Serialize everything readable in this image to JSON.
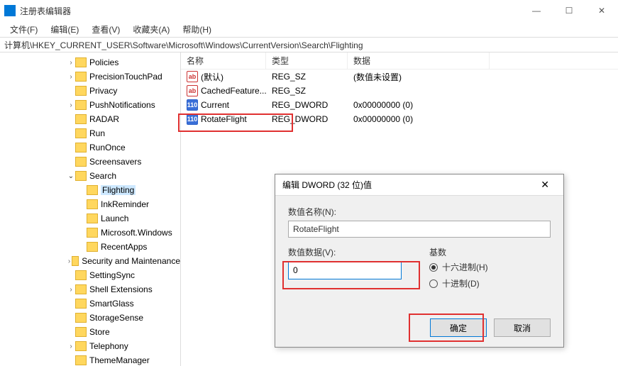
{
  "window": {
    "title": "注册表编辑器",
    "controls": {
      "min": "—",
      "max": "☐",
      "close": "✕"
    }
  },
  "menubar": {
    "file": "文件(F)",
    "edit": "编辑(E)",
    "view": "查看(V)",
    "favorites": "收藏夹(A)",
    "help": "帮助(H)"
  },
  "address": "计算机\\HKEY_CURRENT_USER\\Software\\Microsoft\\Windows\\CurrentVersion\\Search\\Flighting",
  "tree": {
    "items": [
      {
        "depth": 4,
        "chev": ">",
        "label": "Policies"
      },
      {
        "depth": 4,
        "chev": ">",
        "label": "PrecisionTouchPad"
      },
      {
        "depth": 4,
        "chev": "",
        "label": "Privacy"
      },
      {
        "depth": 4,
        "chev": ">",
        "label": "PushNotifications"
      },
      {
        "depth": 4,
        "chev": "",
        "label": "RADAR"
      },
      {
        "depth": 4,
        "chev": "",
        "label": "Run"
      },
      {
        "depth": 4,
        "chev": "",
        "label": "RunOnce"
      },
      {
        "depth": 4,
        "chev": "",
        "label": "Screensavers"
      },
      {
        "depth": 4,
        "chev": "v",
        "label": "Search"
      },
      {
        "depth": 5,
        "chev": "",
        "label": "Flighting",
        "selected": true
      },
      {
        "depth": 5,
        "chev": "",
        "label": "InkReminder"
      },
      {
        "depth": 5,
        "chev": "",
        "label": "Launch"
      },
      {
        "depth": 5,
        "chev": "",
        "label": "Microsoft.Windows"
      },
      {
        "depth": 5,
        "chev": "",
        "label": "RecentApps"
      },
      {
        "depth": 4,
        "chev": ">",
        "label": "Security and Maintenance"
      },
      {
        "depth": 4,
        "chev": "",
        "label": "SettingSync"
      },
      {
        "depth": 4,
        "chev": ">",
        "label": "Shell Extensions"
      },
      {
        "depth": 4,
        "chev": "",
        "label": "SmartGlass"
      },
      {
        "depth": 4,
        "chev": "",
        "label": "StorageSense"
      },
      {
        "depth": 4,
        "chev": "",
        "label": "Store"
      },
      {
        "depth": 4,
        "chev": ">",
        "label": "Telephony"
      },
      {
        "depth": 4,
        "chev": "",
        "label": "ThemeManager"
      }
    ]
  },
  "list": {
    "headers": {
      "name": "名称",
      "type": "类型",
      "data": "数据"
    },
    "rows": [
      {
        "icon": "str",
        "name": "(默认)",
        "type": "REG_SZ",
        "data": "(数值未设置)"
      },
      {
        "icon": "str",
        "name": "CachedFeature...",
        "type": "REG_SZ",
        "data": ""
      },
      {
        "icon": "dw",
        "name": "Current",
        "type": "REG_DWORD",
        "data": "0x00000000 (0)"
      },
      {
        "icon": "dw",
        "name": "RotateFlight",
        "type": "REG_DWORD",
        "data": "0x00000000 (0)"
      }
    ]
  },
  "dialog": {
    "title": "编辑 DWORD (32 位)值",
    "name_label": "数值名称(N):",
    "name_value": "RotateFlight",
    "data_label": "数值数据(V):",
    "data_value": "0",
    "base_label": "基数",
    "radio_hex": "十六进制(H)",
    "radio_dec": "十进制(D)",
    "ok": "确定",
    "cancel": "取消"
  },
  "icons": {
    "ab": "ab",
    "nn": "110"
  }
}
